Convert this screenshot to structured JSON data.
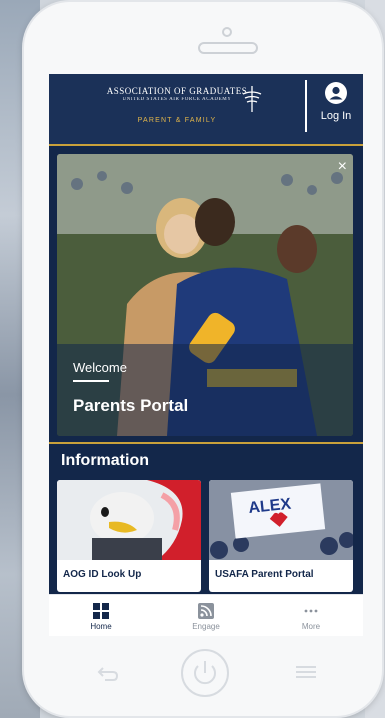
{
  "header": {
    "org_line1": "ASSOCIATION OF GRADUATES",
    "org_line2": "UNITED STATES AIR FORCE ACADEMY",
    "org_line3": "PARENT & FAMILY",
    "login_label": "Log In"
  },
  "hero": {
    "welcome": "Welcome",
    "title": "Parents Portal",
    "close_icon": "×"
  },
  "information": {
    "heading": "Information",
    "cards": [
      {
        "label": "AOG ID Look Up"
      },
      {
        "label": "USAFA Parent Portal"
      }
    ],
    "sign_text": "ALEX"
  },
  "bottom_nav": {
    "items": [
      {
        "label": "Home",
        "icon": "grid-icon",
        "active": true
      },
      {
        "label": "Engage",
        "icon": "rss-icon",
        "active": false
      },
      {
        "label": "More",
        "icon": "more-dots-icon",
        "active": false
      }
    ]
  },
  "colors": {
    "navy": "#13274a",
    "header_navy": "#1b3158",
    "gold": "#c9a13b",
    "nav_active": "#13274a",
    "nav_inactive": "#8b929c"
  }
}
